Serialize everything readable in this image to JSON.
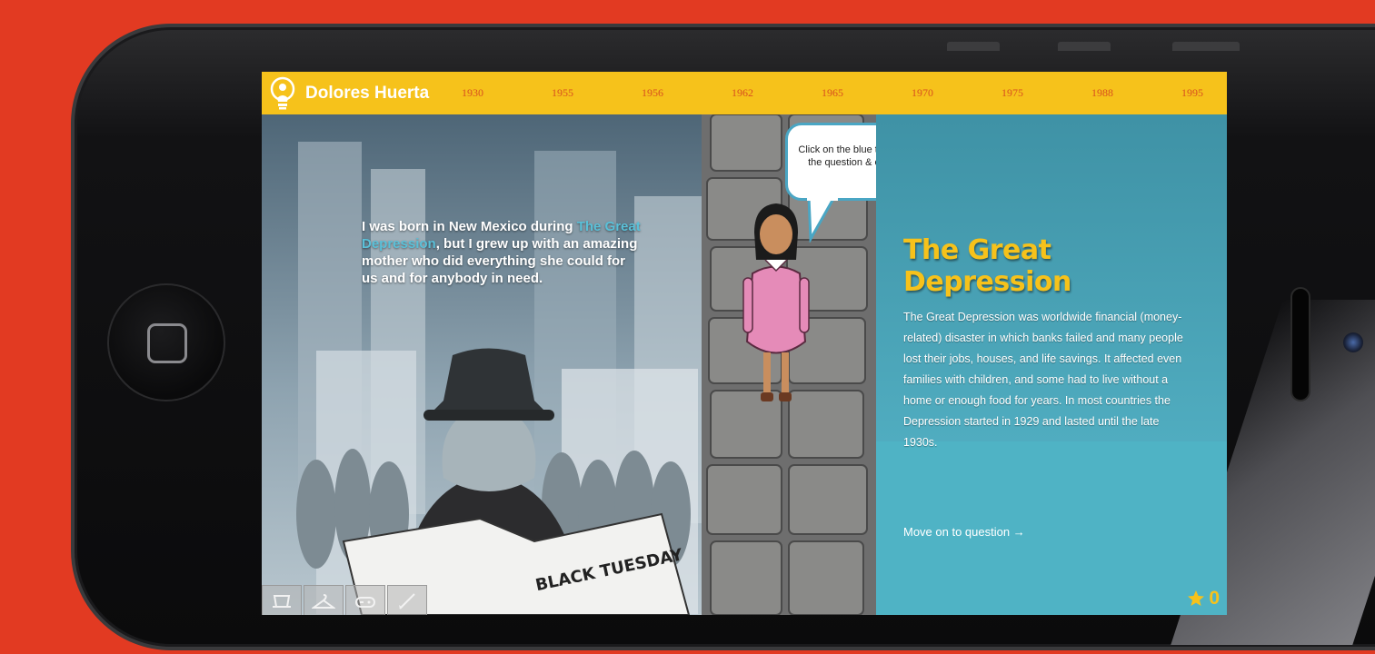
{
  "app": {
    "title": "Dolores Huerta"
  },
  "timeline": [
    "1930",
    "1955",
    "1956",
    "1962",
    "1965",
    "1970",
    "1975",
    "1988",
    "1995"
  ],
  "intro": {
    "before": "I was born in New Mexico during ",
    "link": "The Great Depression",
    "after": ", but I grew up with an amazing mother who did everything she could for us and for anybody in need."
  },
  "newspaper": {
    "headline": "BLACK TUESDAY"
  },
  "hint": {
    "text": "Click on the blue text to unlock the question & earn points"
  },
  "topic": {
    "title": "The Great Depression",
    "body": "The Great Depression was worldwide financial (money-related) disaster in which banks failed and many people lost their jobs, houses, and life savings. It affected even families with children, and some had to live without a home or enough food for years. In most countries the Depression started in 1929 and lasted until the late 1930s.",
    "move_on": "Move on to question →"
  },
  "score": {
    "value": "0",
    "icon": "star-icon"
  },
  "toolbar": [
    "hat-icon",
    "hanger-icon",
    "gamepad-icon",
    "pen-icon"
  ],
  "colors": {
    "background": "#e23a22",
    "topbar": "#f6c21b",
    "panel": "#4fb3c5",
    "link": "#5ac0d8",
    "year": "#d8501f"
  }
}
